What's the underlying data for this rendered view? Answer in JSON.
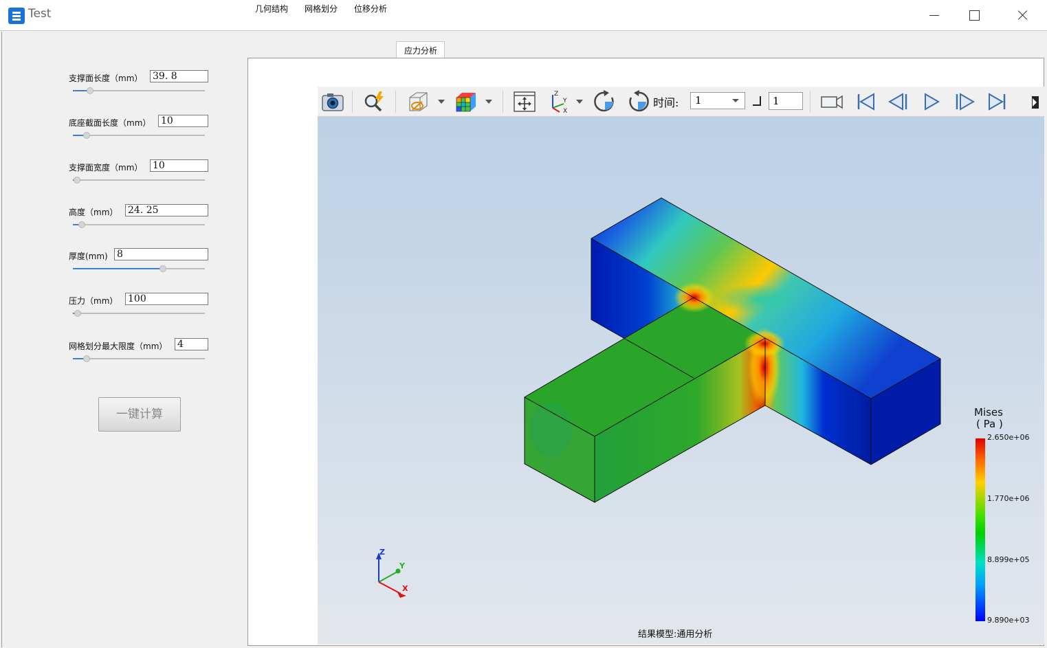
{
  "window": {
    "title": "Test"
  },
  "params": [
    {
      "label": "支撑面长度（mm）",
      "value": "39. 8",
      "slider": 0.13
    },
    {
      "label": "底座截面长度（mm）",
      "value": "10",
      "slider": 0.1
    },
    {
      "label": "支撑面宽度（mm）",
      "value": "10",
      "slider": 0.03
    },
    {
      "label": "高度（mm）",
      "value": "24. 25",
      "slider": 0.07
    },
    {
      "label": "厚度(mm)",
      "value": "8",
      "slider": 0.68
    },
    {
      "label": "压力（mm）",
      "value": "100",
      "slider": 0.04
    },
    {
      "label": "网格划分最大限度（mm）",
      "value": "4",
      "slider": 0.1
    }
  ],
  "calc_button": "一键计算",
  "tabs": [
    "几何结构",
    "网格划分",
    "位移分析",
    "应力分析"
  ],
  "active_tab": "应力分析",
  "toolbar": {
    "time_label": "时间:",
    "time_value": "1",
    "frame_value": "1"
  },
  "legend": {
    "title": "Mises",
    "unit": "( Pa )",
    "ticks": [
      "2.650e+06",
      "1.770e+06",
      "8.899e+05",
      "9.890e+03"
    ]
  },
  "triad": {
    "z": "Z",
    "y": "Y",
    "x": "X"
  },
  "status": "结果模型:通用分析",
  "colors": {
    "accent": "#3b7fd4",
    "app_icon": "#1a73d9"
  }
}
